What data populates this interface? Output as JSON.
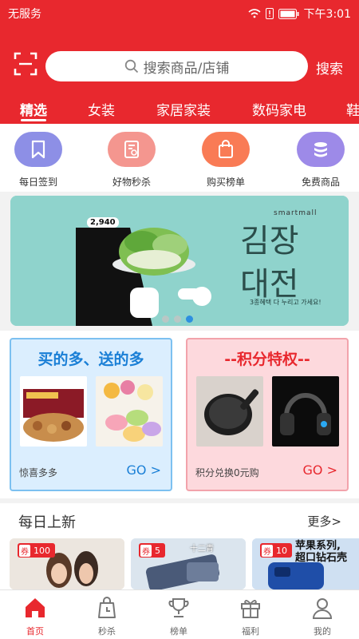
{
  "statusbar": {
    "carrier": "无服务",
    "time": "下午3:01"
  },
  "search": {
    "placeholder": "搜索商品/店铺",
    "button": "搜索"
  },
  "tabs": [
    "精选",
    "女装",
    "家居家装",
    "数码家电",
    "鞋"
  ],
  "quick": [
    {
      "label": "每日签到",
      "icon": "bookmark-icon",
      "color": "#8d8fe6"
    },
    {
      "label": "好物秒杀",
      "icon": "receipt-icon",
      "color": "#f4968f"
    },
    {
      "label": "购买榜单",
      "icon": "shopping-bag-icon",
      "color": "#f97b55"
    },
    {
      "label": "免费商品",
      "icon": "coin-stack-icon",
      "color": "#9d8ae8"
    }
  ],
  "banner": {
    "price": "2,940",
    "brand": "smartmall",
    "headline_line1": "김장",
    "headline_line2": "대전",
    "subtext": "3종혜택 다 누리고 가세요!"
  },
  "promos": [
    {
      "title": "买的多、送的多",
      "subtitle": "惊喜多多",
      "go": "GO >"
    },
    {
      "title": "--积分特权--",
      "subtitle": "积分兑换0元购",
      "go": "GO >"
    }
  ],
  "daily": {
    "title": "每日上新",
    "more": "更多>",
    "cards": [
      {
        "badge_q": "券",
        "badge_value": "100"
      },
      {
        "badge_q": "券",
        "badge_value": "5",
        "caption": "十二青"
      },
      {
        "badge_q": "券",
        "badge_value": "10",
        "caption": "苹果系列,\n超口钻石壳"
      }
    ]
  },
  "tabbar": [
    {
      "label": "首页",
      "icon": "home-icon",
      "active": true
    },
    {
      "label": "秒杀",
      "icon": "clock-bag-icon",
      "active": false
    },
    {
      "label": "榜单",
      "icon": "trophy-icon",
      "active": false
    },
    {
      "label": "福利",
      "icon": "gift-icon",
      "active": false
    },
    {
      "label": "我的",
      "icon": "user-icon",
      "active": false
    }
  ],
  "colors": {
    "brand": "#e8282e",
    "blue": "#1a7fd6"
  }
}
